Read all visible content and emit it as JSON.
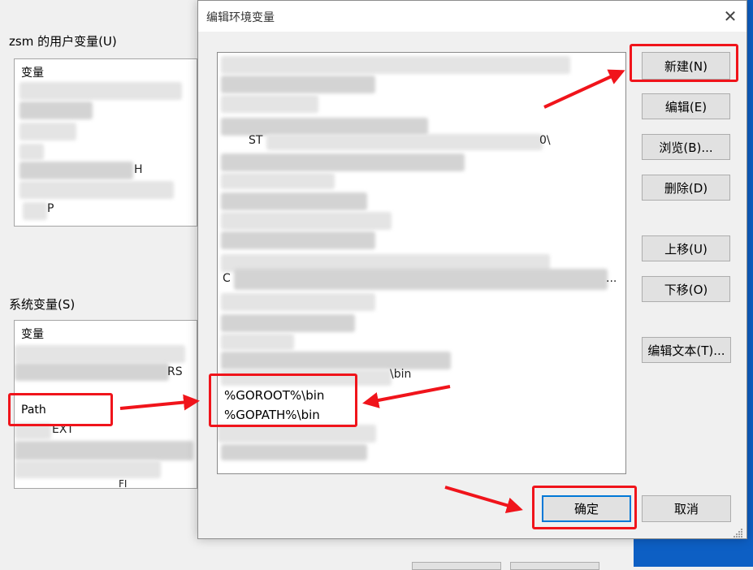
{
  "background": {
    "user_vars_title": "zsm 的用户变量(U)",
    "user_vars_header": "变量",
    "user_vars_peeks": [
      "H",
      "P"
    ],
    "sys_vars_title": "系统变量(S)",
    "sys_vars_header": "变量",
    "sys_vars_peeks": [
      "RS",
      "EXT",
      "FI"
    ],
    "path_row": "Path"
  },
  "dialog": {
    "title": "编辑环境变量",
    "close_glyph": "✕",
    "list_peeks": {
      "row_st": "ST",
      "row_0": "0\\",
      "row_c": "C",
      "row_ellipsis": "...",
      "row_bin": "\\bin"
    },
    "list_items": [
      "%GOROOT%\\bin",
      "%GOPATH%\\bin"
    ],
    "buttons": {
      "new": "新建(N)",
      "edit": "编辑(E)",
      "browse": "浏览(B)...",
      "delete": "删除(D)",
      "move_up": "上移(U)",
      "move_down": "下移(O)",
      "edit_text": "编辑文本(T)...",
      "ok": "确定",
      "cancel": "取消"
    }
  },
  "colors": {
    "annotation_red": "#f0141b",
    "accent_blue": "#0078d7",
    "desktop_blue": "#0d5fc4"
  },
  "icons": {
    "close": "close-icon",
    "resize": "resize-grip-icon",
    "annotation_arrow": "red-arrow-icon"
  }
}
